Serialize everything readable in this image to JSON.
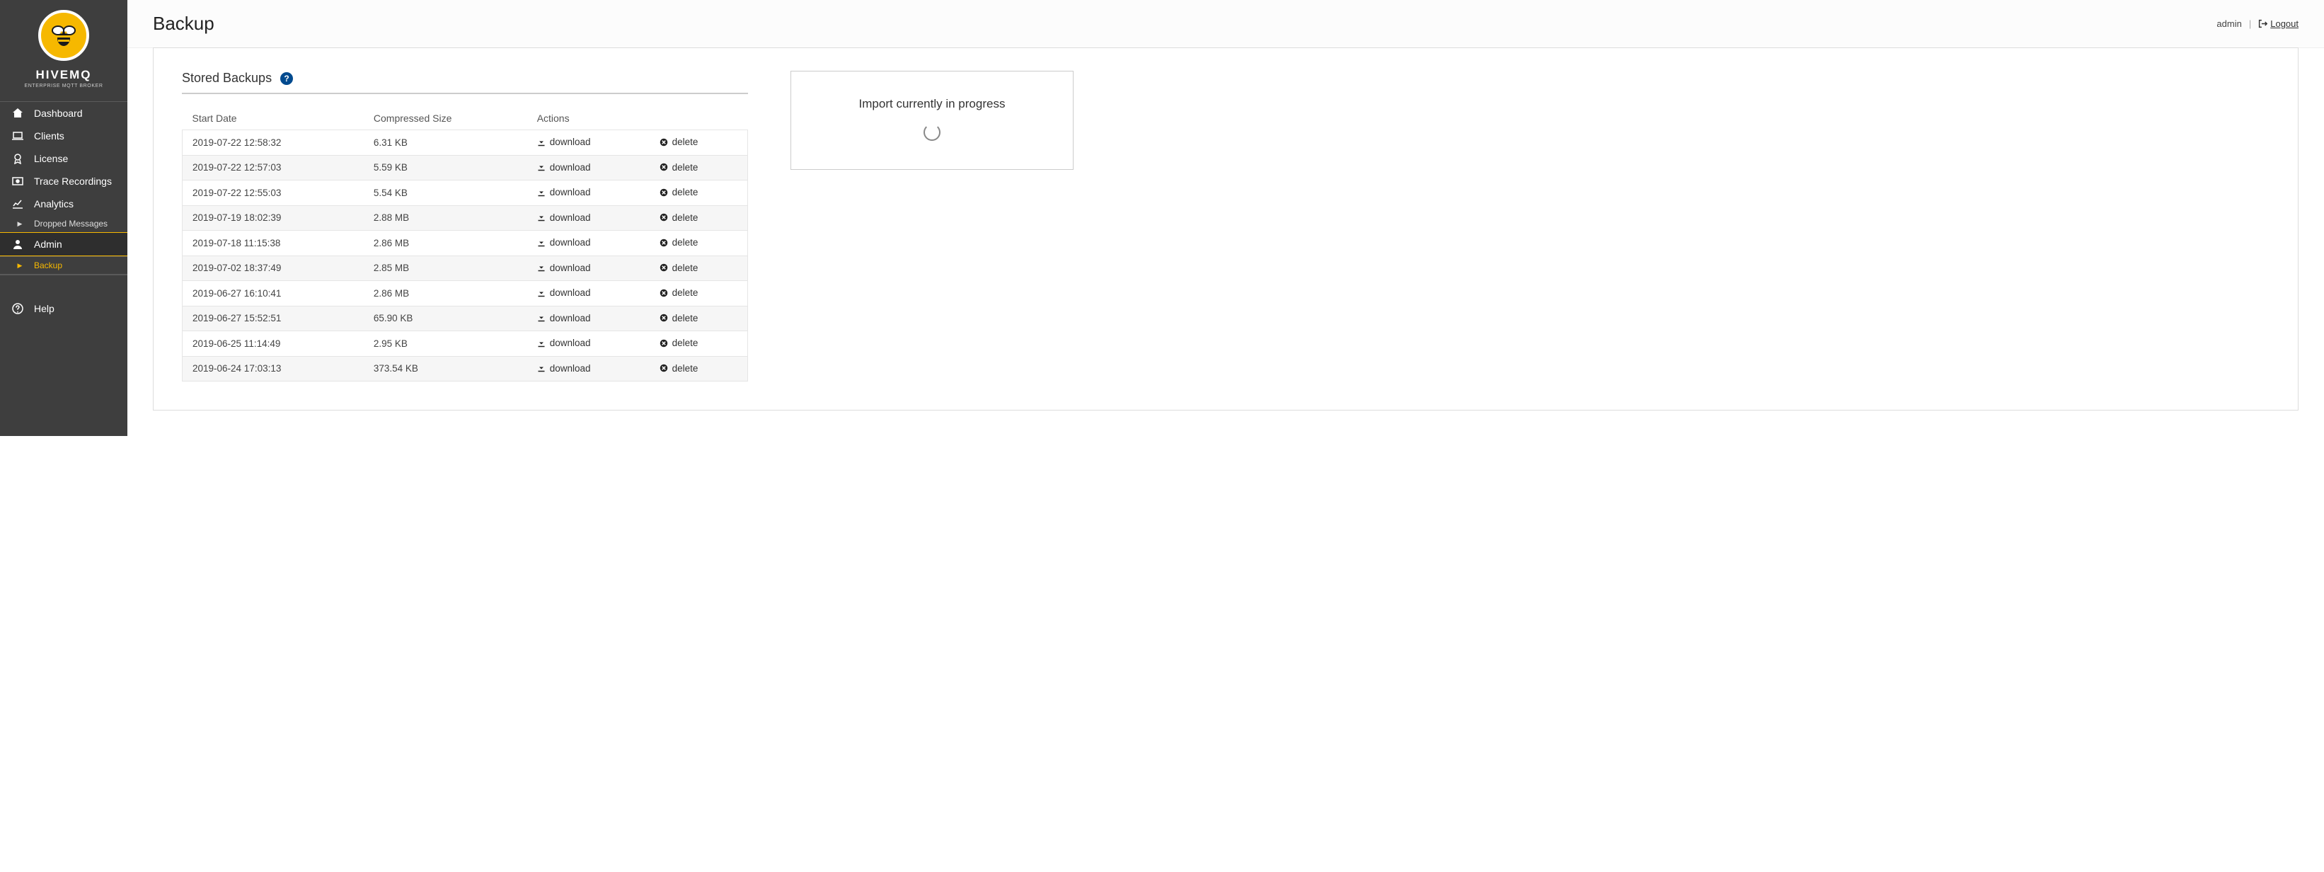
{
  "brand": {
    "name": "HIVEMQ",
    "tagline": "ENTERPRISE MQTT BROKER"
  },
  "sidebar": {
    "items": [
      {
        "label": "Dashboard"
      },
      {
        "label": "Clients"
      },
      {
        "label": "License"
      },
      {
        "label": "Trace Recordings"
      },
      {
        "label": "Analytics"
      },
      {
        "label": "Admin"
      }
    ],
    "analytics_sub": {
      "label": "Dropped Messages"
    },
    "admin_sub": {
      "label": "Backup"
    },
    "help": {
      "label": "Help"
    }
  },
  "header": {
    "title": "Backup",
    "username": "admin",
    "logout": "Logout"
  },
  "section": {
    "title": "Stored Backups",
    "columns": {
      "start_date": "Start Date",
      "compressed_size": "Compressed Size",
      "actions": "Actions"
    },
    "download_label": "download",
    "delete_label": "delete"
  },
  "backups": [
    {
      "start_date": "2019-07-22 12:58:32",
      "size": "6.31 KB"
    },
    {
      "start_date": "2019-07-22 12:57:03",
      "size": "5.59 KB"
    },
    {
      "start_date": "2019-07-22 12:55:03",
      "size": "5.54 KB"
    },
    {
      "start_date": "2019-07-19 18:02:39",
      "size": "2.88 MB"
    },
    {
      "start_date": "2019-07-18 11:15:38",
      "size": "2.86 MB"
    },
    {
      "start_date": "2019-07-02 18:37:49",
      "size": "2.85 MB"
    },
    {
      "start_date": "2019-06-27 16:10:41",
      "size": "2.86 MB"
    },
    {
      "start_date": "2019-06-27 15:52:51",
      "size": "65.90 KB"
    },
    {
      "start_date": "2019-06-25 11:14:49",
      "size": "2.95 KB"
    },
    {
      "start_date": "2019-06-24 17:03:13",
      "size": "373.54 KB"
    }
  ],
  "import": {
    "message": "Import currently in progress"
  }
}
